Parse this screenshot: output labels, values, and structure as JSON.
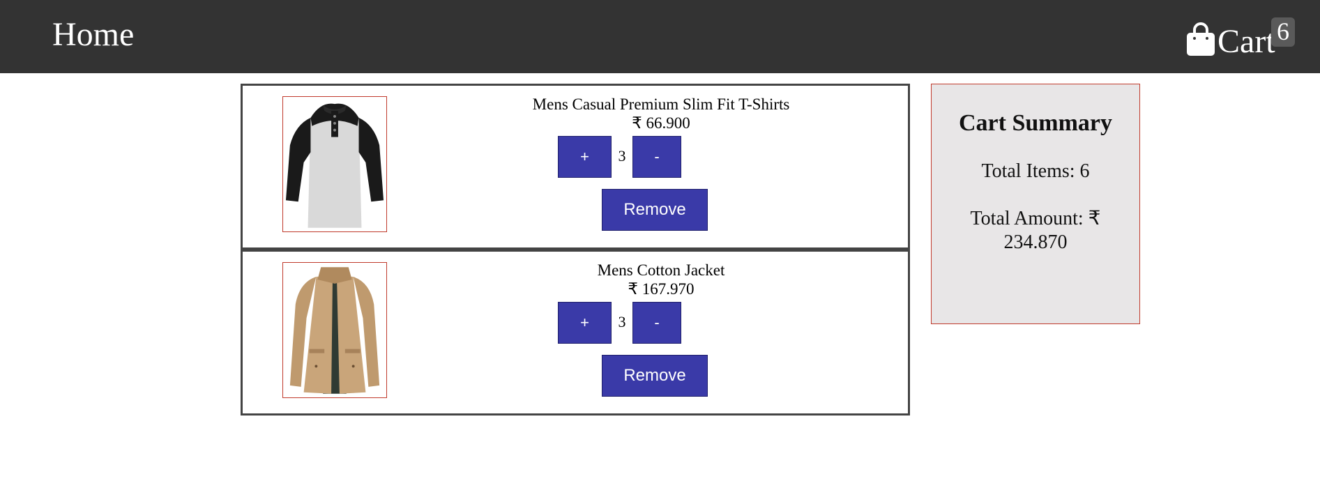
{
  "nav": {
    "home_label": "Home",
    "cart_label": "Cart",
    "cart_count": "6"
  },
  "items": [
    {
      "title": "Mens Casual Premium Slim Fit T-Shirts",
      "price": "₹ 66.900",
      "quantity": "3",
      "plus_label": "+",
      "minus_label": "-",
      "remove_label": "Remove"
    },
    {
      "title": "Mens Cotton Jacket",
      "price": "₹ 167.970",
      "quantity": "3",
      "plus_label": "+",
      "minus_label": "-",
      "remove_label": "Remove"
    }
  ],
  "summary": {
    "title": "Cart Summary",
    "total_items": "Total Items: 6",
    "total_amount": "Total Amount: ₹ 234.870"
  },
  "colors": {
    "navbar": "#333333",
    "button": "#3a3aa8",
    "summary_bg": "#e8e6e7",
    "image_border": "#c0392b"
  }
}
